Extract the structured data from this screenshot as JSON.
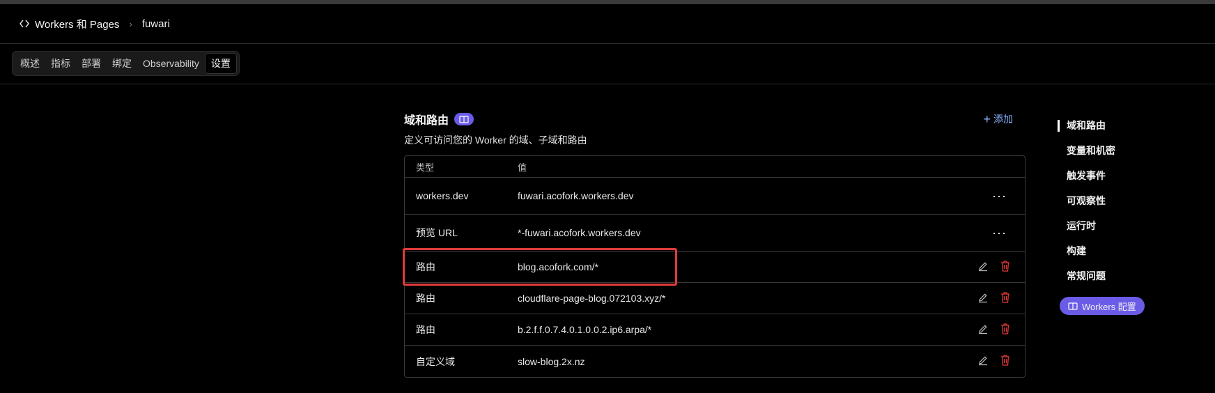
{
  "breadcrumb": {
    "root": "Workers 和 Pages",
    "current": "fuwari"
  },
  "tabs": [
    {
      "label": "概述"
    },
    {
      "label": "指标"
    },
    {
      "label": "部署"
    },
    {
      "label": "绑定"
    },
    {
      "label": "Observability"
    },
    {
      "label": "设置"
    }
  ],
  "section": {
    "title": "域和路由",
    "add_label": "添加",
    "description": "定义可访问您的 Worker 的域、子域和路由"
  },
  "table": {
    "columns": [
      "类型",
      "值"
    ],
    "rows": [
      {
        "type": "workers.dev",
        "value": "fuwari.acofork.workers.dev"
      },
      {
        "type": "预览 URL",
        "value": "*-fuwari.acofork.workers.dev"
      },
      {
        "type": "路由",
        "value": "blog.acofork.com/*"
      },
      {
        "type": "路由",
        "value": "cloudflare-page-blog.072103.xyz/*"
      },
      {
        "type": "路由",
        "value": "b.2.f.f.0.7.4.0.1.0.0.2.ip6.arpa/*"
      },
      {
        "type": "自定义域",
        "value": "slow-blog.2x.nz"
      }
    ]
  },
  "right_nav": {
    "items": [
      {
        "label": "域和路由"
      },
      {
        "label": "变量和机密"
      },
      {
        "label": "触发事件"
      },
      {
        "label": "可观察性"
      },
      {
        "label": "运行时"
      },
      {
        "label": "构建"
      },
      {
        "label": "常规问题"
      }
    ],
    "badge": "Workers 配置"
  },
  "colors": {
    "accent_purple": "#6b5ce7",
    "link_blue": "#8ab4ff",
    "delete_red": "#e23b3b",
    "highlight_red": "#e23b3b"
  }
}
